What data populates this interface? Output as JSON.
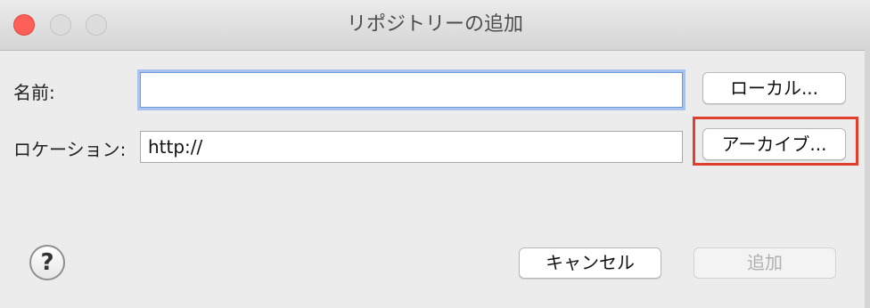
{
  "window": {
    "title": "リポジトリーの追加"
  },
  "form": {
    "name_label": "名前:",
    "name_value": "",
    "location_label": "ロケーション:",
    "location_value": "http://"
  },
  "buttons": {
    "local": "ローカル...",
    "archive": "アーカイブ...",
    "cancel": "キャンセル",
    "add": "追加"
  },
  "help": {
    "symbol": "?"
  },
  "icons": {
    "close": "close-icon",
    "minimize": "minimize-icon",
    "zoom": "zoom-icon",
    "help": "help-icon"
  },
  "colors": {
    "highlight_border": "#e0402b",
    "focus_ring": "#a8c3ee",
    "close_button": "#fe5f57"
  },
  "state": {
    "add_enabled": false,
    "focused_field": "name"
  }
}
